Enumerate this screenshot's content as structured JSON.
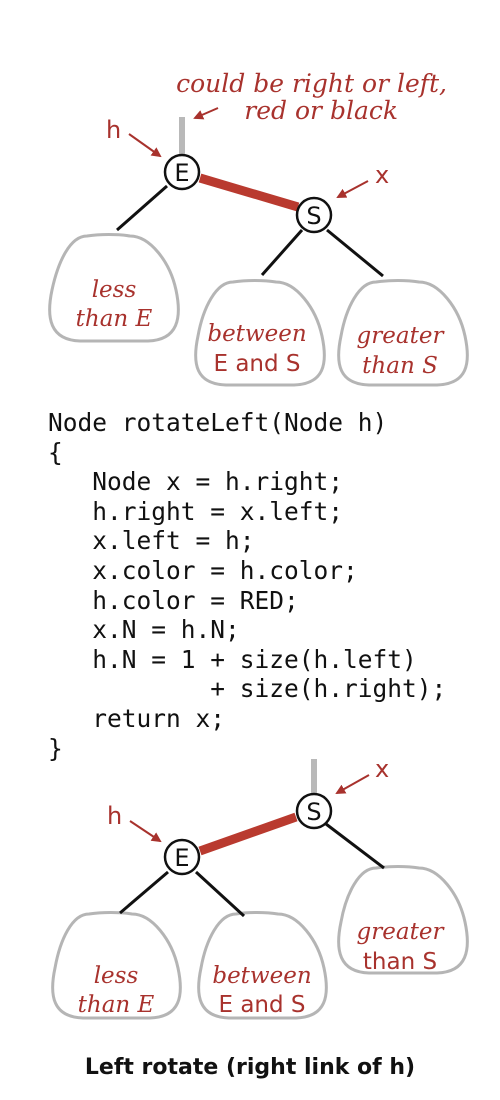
{
  "top_diagram": {
    "note_line1": "could be right or left,",
    "note_line2": "red or black",
    "h_label": "h",
    "x_label": "x",
    "node_e": "E",
    "node_s": "S",
    "subtree_left": {
      "line1": "less",
      "line2": "than E"
    },
    "subtree_middle": {
      "line1": "between",
      "line2": "E and S"
    },
    "subtree_right": {
      "line1": "greater",
      "line2": "than S"
    }
  },
  "code": {
    "lines": [
      "Node rotateLeft(Node h)",
      "{",
      "   Node x = h.right;",
      "   h.right = x.left;",
      "   x.left = h;",
      "   x.color = h.color;",
      "   h.color = RED;",
      "   x.N = h.N;",
      "   h.N = 1 + size(h.left)",
      "           + size(h.right);",
      "   return x;",
      "}"
    ]
  },
  "bottom_diagram": {
    "h_label": "h",
    "x_label": "x",
    "node_e": "E",
    "node_s": "S",
    "subtree_left": {
      "line1": "less",
      "line2": "than E"
    },
    "subtree_middle": {
      "line1": "between",
      "line2": "E and S"
    },
    "subtree_right": {
      "line1": "greater",
      "line2": "than S"
    }
  },
  "caption": "Left rotate (right link of h)",
  "colors": {
    "red_link": "#b93a2f",
    "label_red": "#a8322d",
    "subtree_outline": "#b5b5b5",
    "top_link": "#b9b9b9"
  }
}
